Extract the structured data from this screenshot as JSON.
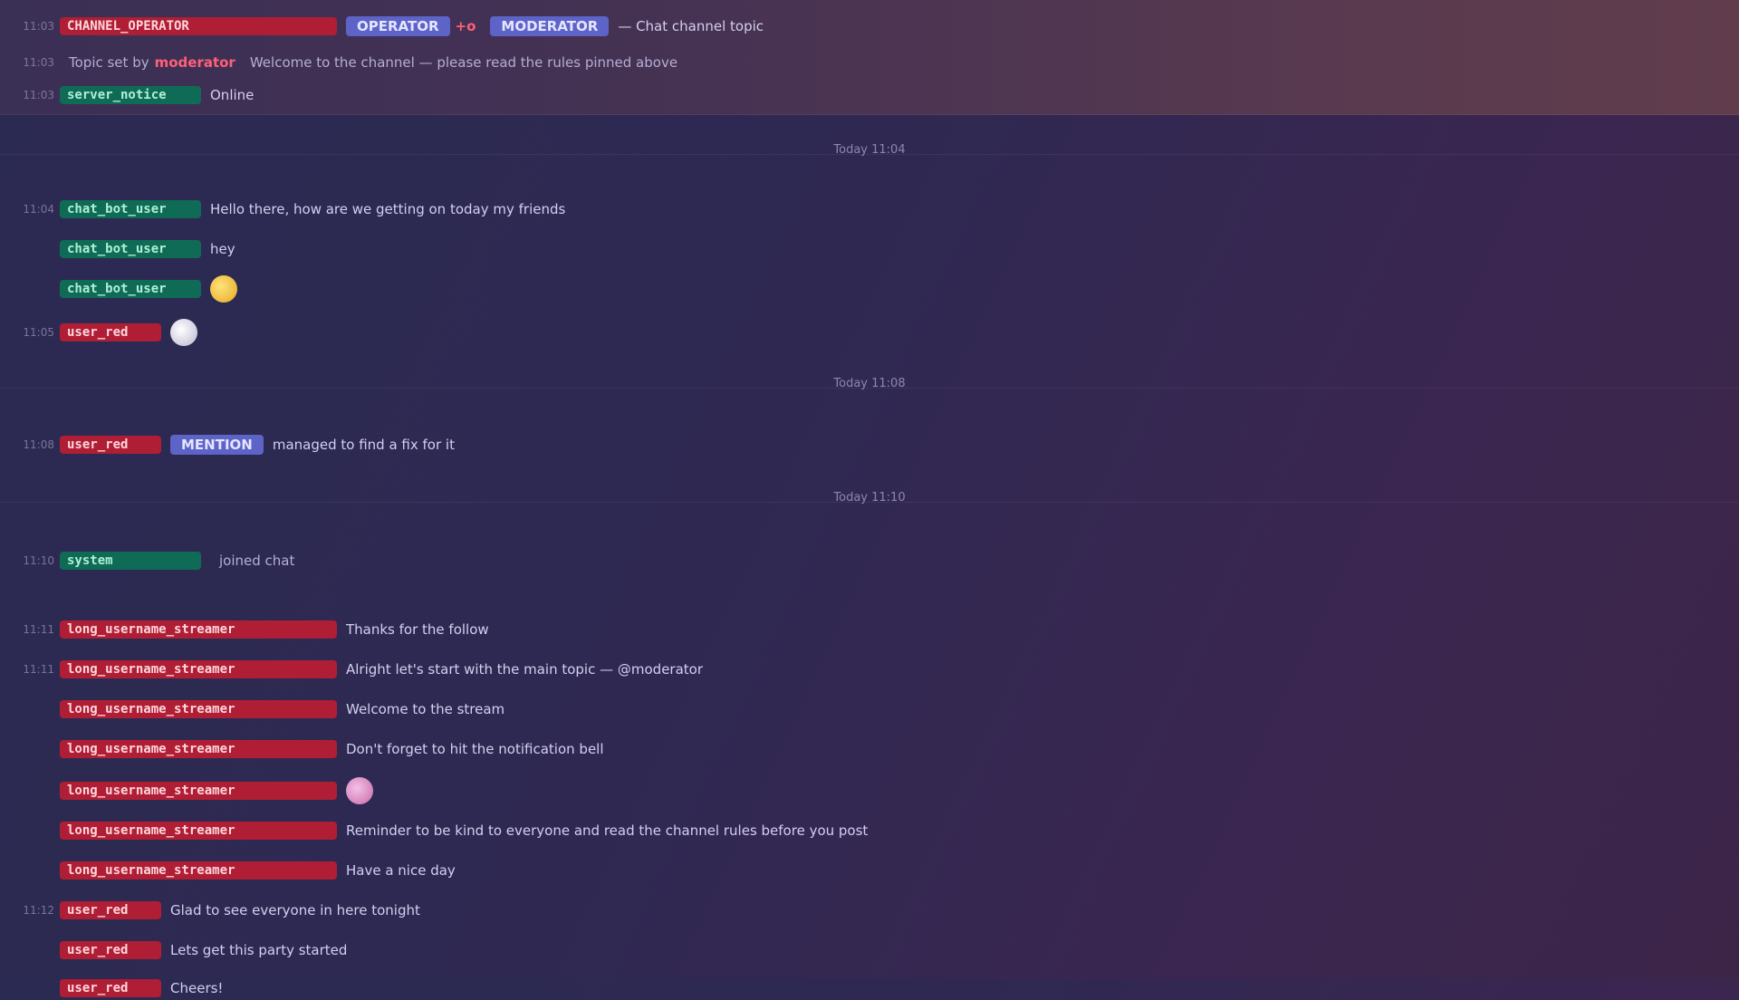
{
  "header": {
    "line1": {
      "timestamp": "11:03",
      "user": "CHANNEL_OPERATOR",
      "badge1": "OPERATOR",
      "badge_icon": "+o",
      "badge2": "MODERATOR",
      "text": "— Chat channel topic"
    },
    "line2": {
      "timestamp": "11:03",
      "label": "Topic set by",
      "user": "moderator",
      "text": "Welcome to the channel — please read the rules pinned above"
    },
    "line3": {
      "timestamp": "11:03",
      "user": "server_notice",
      "text": "Online"
    }
  },
  "dividers": [
    "Today 11:04",
    "Today 11:08",
    "Today 11:10"
  ],
  "messages": [
    {
      "ts": "11:04",
      "user": "chat_bot_user",
      "user_color": "green",
      "text": "Hello there, how are we getting on today my friends"
    },
    {
      "ts": "",
      "user": "chat_bot_user",
      "user_color": "green",
      "text": "hey"
    },
    {
      "ts": "",
      "user": "chat_bot_user",
      "user_color": "green",
      "emoji": "yellow"
    },
    {
      "ts": "11:05",
      "user": "user_red",
      "user_color": "red",
      "emoji": "white"
    },
    {
      "ts": "11:08",
      "user": "user_red",
      "user_color": "red",
      "chip": "MENTION",
      "text": "managed to find a fix for it"
    },
    {
      "ts": "11:10",
      "user": "system",
      "user_color": "green",
      "text": "",
      "sub": "joined chat"
    },
    {
      "ts": "11:11",
      "user": "long_username_streamer",
      "user_color": "red-long",
      "text": "Thanks for the follow"
    },
    {
      "ts": "11:11",
      "user": "long_username_streamer",
      "user_color": "red-long",
      "text": "Alright let's start with the main topic — @moderator"
    },
    {
      "ts": "",
      "user": "long_username_streamer",
      "user_color": "red-long",
      "text": "Welcome to the stream"
    },
    {
      "ts": "",
      "user": "long_username_streamer",
      "user_color": "red-long",
      "text": "Don't forget to hit the notification bell"
    },
    {
      "ts": "",
      "user": "long_username_streamer",
      "user_color": "red-long",
      "emoji": "pink"
    },
    {
      "ts": "",
      "user": "long_username_streamer",
      "user_color": "red-long",
      "text": "Reminder to be kind to everyone and read the channel rules before you post"
    },
    {
      "ts": "",
      "user": "long_username_streamer",
      "user_color": "red-long",
      "text": "Have a nice day"
    },
    {
      "ts": "11:12",
      "user": "user_red",
      "user_color": "red",
      "text": "Glad to see everyone in here tonight"
    },
    {
      "ts": "",
      "user": "user_red",
      "user_color": "red",
      "text": "Lets get this party started"
    },
    {
      "ts": "",
      "user": "user_red",
      "user_color": "red",
      "text": "Cheers!"
    }
  ]
}
